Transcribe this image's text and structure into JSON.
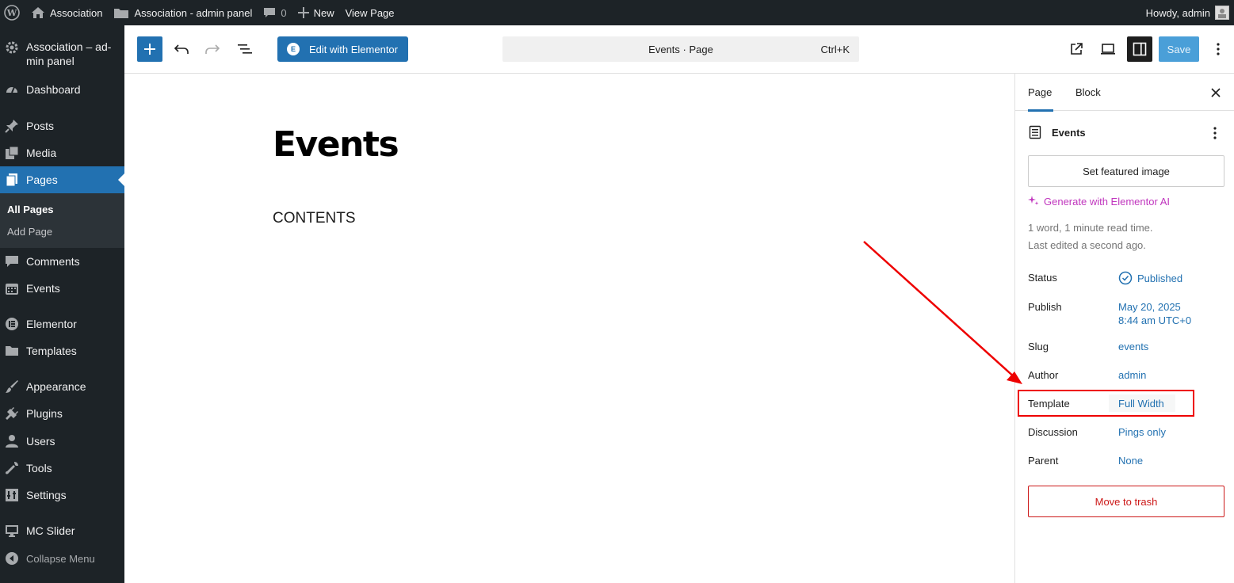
{
  "adminbar": {
    "site_name": "Association",
    "panel_name": "Association - admin panel",
    "comments_count": "0",
    "new_label": "New",
    "view_page_label": "View Page",
    "howdy": "Howdy, admin"
  },
  "menu": {
    "items": [
      {
        "label": "Association – ad-",
        "label2": "min panel",
        "icon": "gear-icon"
      },
      {
        "label": "Dashboard",
        "icon": "dashboard-icon"
      },
      {
        "label": "Posts",
        "icon": "pin-icon"
      },
      {
        "label": "Media",
        "icon": "media-icon"
      },
      {
        "label": "Pages",
        "icon": "pages-icon"
      },
      {
        "label": "Comments",
        "icon": "comment-icon"
      },
      {
        "label": "Events",
        "icon": "calendar-icon"
      },
      {
        "label": "Elementor",
        "icon": "elementor-icon"
      },
      {
        "label": "Templates",
        "icon": "folder-icon"
      },
      {
        "label": "Appearance",
        "icon": "brush-icon"
      },
      {
        "label": "Plugins",
        "icon": "plug-icon"
      },
      {
        "label": "Users",
        "icon": "user-icon"
      },
      {
        "label": "Tools",
        "icon": "wrench-icon"
      },
      {
        "label": "Settings",
        "icon": "settings-icon"
      },
      {
        "label": "MC Slider",
        "icon": "monitor-icon"
      }
    ],
    "submenu": {
      "all_pages": "All Pages",
      "add_page": "Add Page"
    },
    "collapse": "Collapse Menu"
  },
  "toolbar": {
    "elementor_label": "Edit with Elementor",
    "command_text": "Events · Page",
    "command_shortcut": "Ctrl+K",
    "save_label": "Save"
  },
  "post": {
    "title": "Events",
    "content": "CONTENTS"
  },
  "sidebar": {
    "tab_page": "Page",
    "tab_block": "Block",
    "doc_title": "Events",
    "featured_image": "Set featured image",
    "generate_ai": "Generate with Elementor AI",
    "meta_words": "1 word, 1 minute read time.",
    "meta_edited": "Last edited a second ago.",
    "rows": {
      "status": {
        "label": "Status",
        "value": "Published"
      },
      "publish": {
        "label": "Publish",
        "value": "May 20, 2025",
        "value2": "8:44 am UTC+0"
      },
      "slug": {
        "label": "Slug",
        "value": "events"
      },
      "author": {
        "label": "Author",
        "value": "admin"
      },
      "template": {
        "label": "Template",
        "value": "Full Width"
      },
      "discussion": {
        "label": "Discussion",
        "value": "Pings only"
      },
      "parent": {
        "label": "Parent",
        "value": "None"
      }
    },
    "trash": "Move to trash"
  },
  "colors": {
    "accent": "#2271b1",
    "admin_dark": "#1d2327",
    "ai_magenta": "#c036be",
    "annotation_red": "#e00"
  }
}
